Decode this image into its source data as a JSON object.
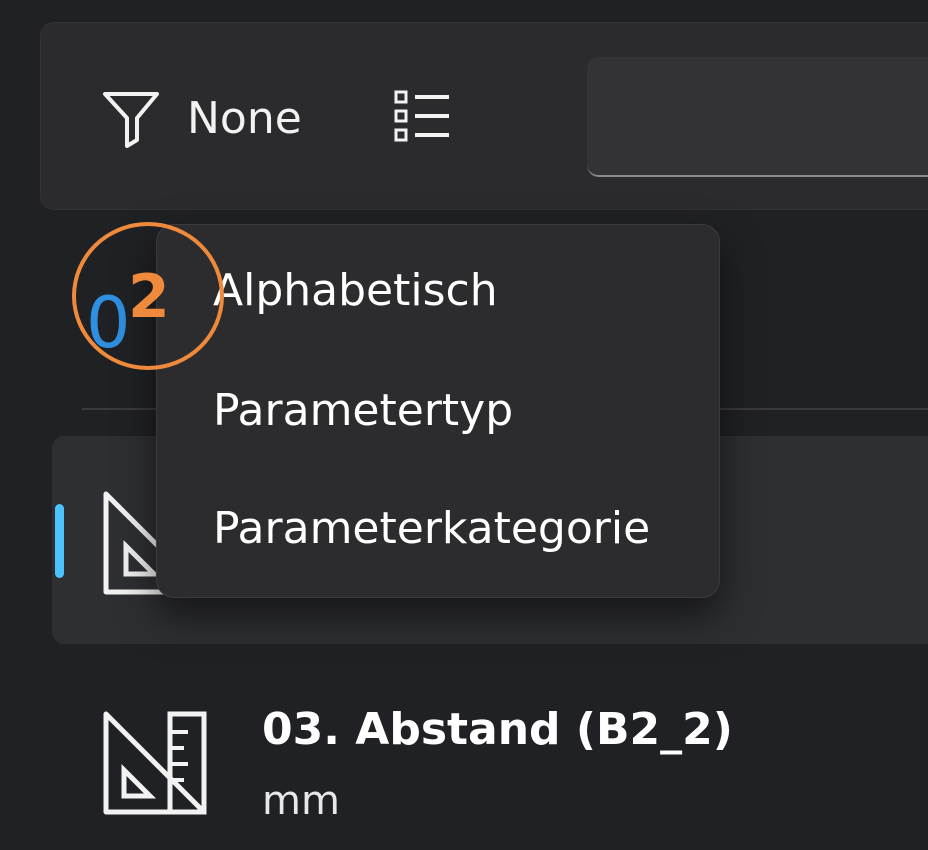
{
  "toolbar": {
    "filter_label": "None",
    "filter_icon": "filter-icon",
    "sort_icon": "list-sort-icon",
    "search_value": ""
  },
  "partial_text": "0",
  "sort_menu": {
    "items": [
      {
        "label": "Alphabetisch"
      },
      {
        "label": "Parametertyp"
      },
      {
        "label": "Parameterkategorie"
      }
    ]
  },
  "list": {
    "items": [
      {
        "icon": "triangle-ruler-icon",
        "title": "",
        "unit": ""
      },
      {
        "icon": "triangle-ruler-icon",
        "title": "03. Abstand (B2_2)",
        "unit": "mm"
      }
    ]
  },
  "annotation": {
    "number": "2",
    "color": "#ef8a3c"
  },
  "colors": {
    "accent": "#4cc2ff",
    "background": "#202124",
    "menu_bg": "#2c2c2e"
  }
}
